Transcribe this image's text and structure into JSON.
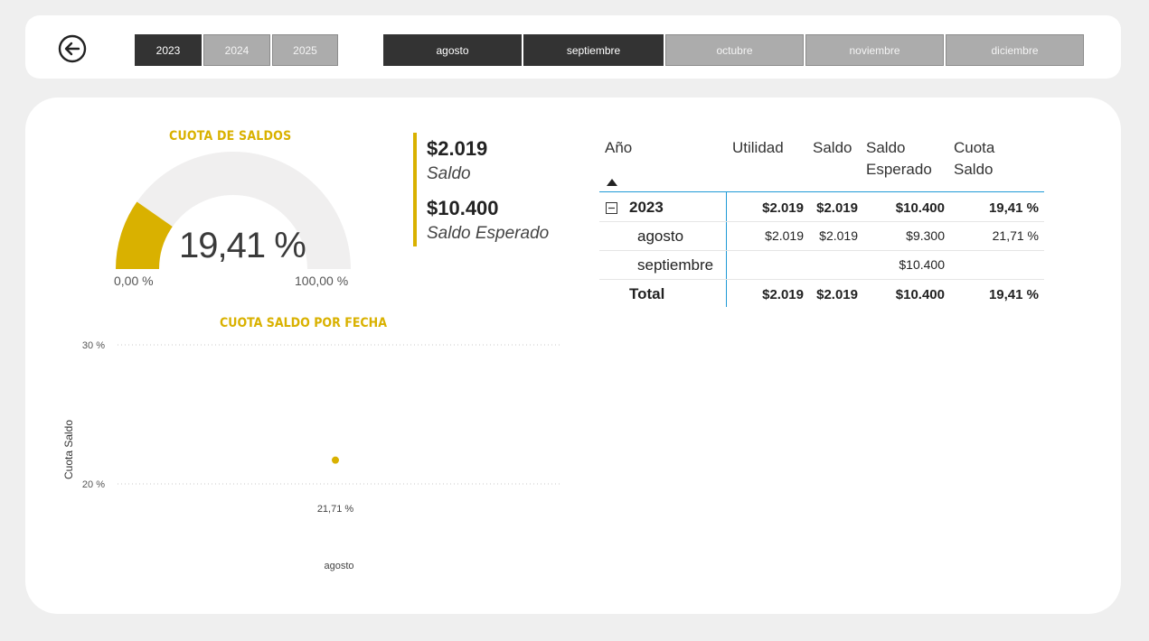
{
  "header": {
    "back_icon": "arrow-left-circle-icon",
    "years": [
      {
        "label": "2023",
        "selected": true
      },
      {
        "label": "2024",
        "selected": false
      },
      {
        "label": "2025",
        "selected": false
      }
    ],
    "months": [
      {
        "label": "agosto",
        "selected": true
      },
      {
        "label": "septiembre",
        "selected": true
      },
      {
        "label": "octubre",
        "selected": false
      },
      {
        "label": "noviembre",
        "selected": false
      },
      {
        "label": "diciembre",
        "selected": false
      }
    ]
  },
  "gauge": {
    "title": "CUOTA DE SALDOS",
    "value_label": "19,41 %",
    "value": 19.41,
    "min_label": "0,00 %",
    "max_label": "100,00 %",
    "min": 0,
    "max": 100,
    "fill_color": "#d9b100",
    "track_color": "#f0efef"
  },
  "kpis": {
    "saldo_value": "$2.019",
    "saldo_label": "Saldo",
    "esperado_value": "$10.400",
    "esperado_label": "Saldo Esperado"
  },
  "matrix": {
    "headers": {
      "anio": "Año",
      "utilidad": "Utilidad",
      "saldo": "Saldo",
      "saldo_esperado_1": "Saldo",
      "saldo_esperado_2": "Esperado",
      "cuota_1": "Cuota",
      "cuota_2": "Saldo"
    },
    "rows": [
      {
        "label": "2023",
        "utilidad": "$2.019",
        "saldo": "$2.019",
        "esperado": "$10.400",
        "cuota": "19,41 %"
      },
      {
        "label": "agosto",
        "utilidad": "$2.019",
        "saldo": "$2.019",
        "esperado": "$9.300",
        "cuota": "21,71 %"
      },
      {
        "label": "septiembre",
        "utilidad": "",
        "saldo": "",
        "esperado": "$10.400",
        "cuota": ""
      },
      {
        "label": "Total",
        "utilidad": "$2.019",
        "saldo": "$2.019",
        "esperado": "$10.400",
        "cuota": "19,41 %"
      }
    ],
    "expand_icon": "minus-square-icon",
    "sort_icon": "sort-up-icon",
    "accent_color": "#1f9ad6"
  },
  "chart_data": {
    "type": "scatter",
    "title": "CUOTA SALDO POR FECHA",
    "ylabel": "Cuota Saldo",
    "xlabel": "",
    "categories": [
      "agosto"
    ],
    "series": [
      {
        "values": [
          21.71
        ],
        "data_labels": [
          "21,71 %"
        ],
        "color": "#d9b100"
      }
    ],
    "y_ticks": [
      {
        "value": 30,
        "label": "30 %"
      },
      {
        "value": 20,
        "label": "20 %"
      }
    ],
    "ylim": [
      20,
      30
    ],
    "grid": true
  }
}
